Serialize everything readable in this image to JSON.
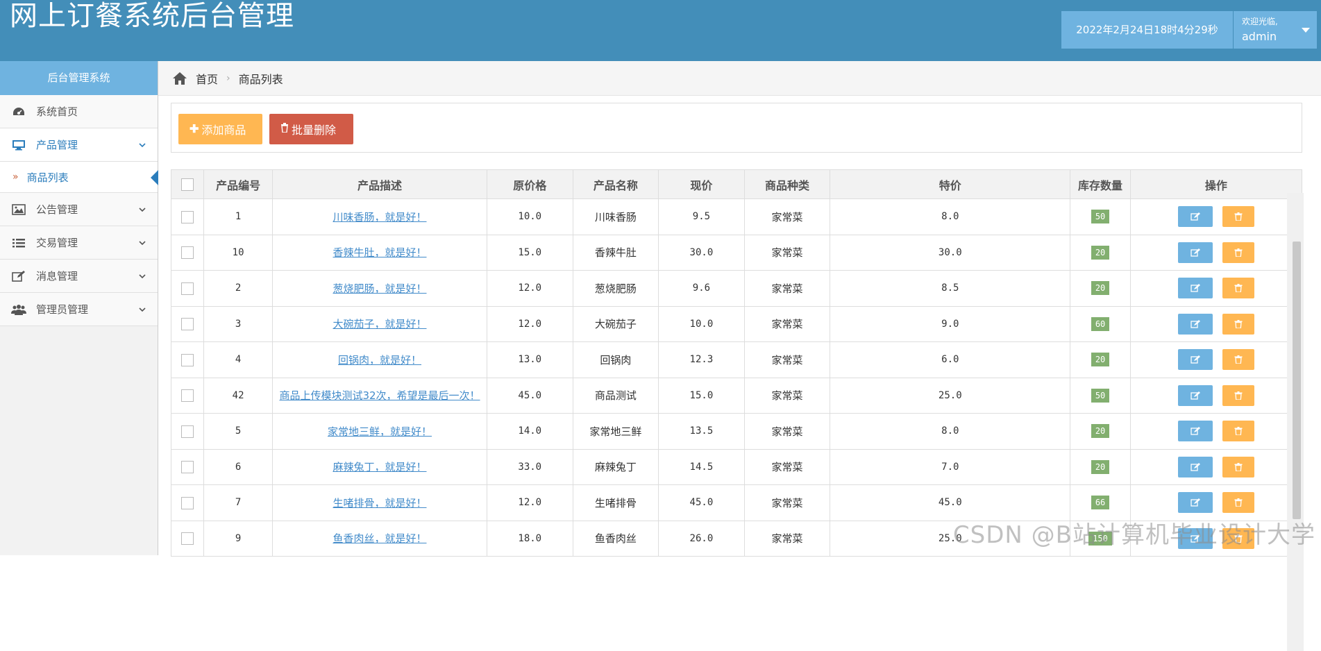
{
  "header": {
    "app_title": "网上订餐系统后台管理",
    "datetime": "2022年2月24日18时4分29秒",
    "welcome": "欢迎光临,",
    "username": "admin"
  },
  "sidebar": {
    "title": "后台管理系统",
    "items": [
      {
        "label": "系统首页",
        "icon": "dashboard-icon"
      },
      {
        "label": "产品管理",
        "icon": "desktop-icon"
      },
      {
        "label": "公告管理",
        "icon": "picture-icon"
      },
      {
        "label": "交易管理",
        "icon": "list-icon"
      },
      {
        "label": "消息管理",
        "icon": "edit-icon"
      },
      {
        "label": "管理员管理",
        "icon": "users-icon"
      }
    ],
    "sub_item": "商品列表"
  },
  "breadcrumb": {
    "home": "首页",
    "current": "商品列表"
  },
  "toolbar": {
    "add_label": "添加商品",
    "delete_label": "批量删除"
  },
  "table": {
    "headers": [
      "产品编号",
      "产品描述",
      "原价格",
      "产品名称",
      "现价",
      "商品种类",
      "特价",
      "库存数量",
      "操作"
    ],
    "rows": [
      {
        "id": "1",
        "desc": "川味香肠，就是好！",
        "orig": "10.0",
        "name": "川味香肠",
        "price": "9.5",
        "type": "家常菜",
        "special": "8.0",
        "stock": "50"
      },
      {
        "id": "10",
        "desc": "香辣牛肚，就是好！",
        "orig": "15.0",
        "name": "香辣牛肚",
        "price": "30.0",
        "type": "家常菜",
        "special": "30.0",
        "stock": "20"
      },
      {
        "id": "2",
        "desc": "葱烧肥肠，就是好！",
        "orig": "12.0",
        "name": "葱烧肥肠",
        "price": "9.6",
        "type": "家常菜",
        "special": "8.5",
        "stock": "20"
      },
      {
        "id": "3",
        "desc": "大碗茄子，就是好！",
        "orig": "12.0",
        "name": "大碗茄子",
        "price": "10.0",
        "type": "家常菜",
        "special": "9.0",
        "stock": "60"
      },
      {
        "id": "4",
        "desc": "回锅肉，就是好！",
        "orig": "13.0",
        "name": "回锅肉",
        "price": "12.3",
        "type": "家常菜",
        "special": "6.0",
        "stock": "20"
      },
      {
        "id": "42",
        "desc": "商品上传模块测试32次，希望是最后一次！",
        "orig": "45.0",
        "name": "商品测试",
        "price": "15.0",
        "type": "家常菜",
        "special": "25.0",
        "stock": "50"
      },
      {
        "id": "5",
        "desc": "家常地三鲜，就是好！",
        "orig": "14.0",
        "name": "家常地三鲜",
        "price": "13.5",
        "type": "家常菜",
        "special": "8.0",
        "stock": "20"
      },
      {
        "id": "6",
        "desc": "麻辣兔丁，就是好！",
        "orig": "33.0",
        "name": "麻辣兔丁",
        "price": "14.5",
        "type": "家常菜",
        "special": "7.0",
        "stock": "20"
      },
      {
        "id": "7",
        "desc": "生啫排骨，就是好！",
        "orig": "12.0",
        "name": "生啫排骨",
        "price": "45.0",
        "type": "家常菜",
        "special": "45.0",
        "stock": "66"
      },
      {
        "id": "9",
        "desc": "鱼香肉丝，就是好！",
        "orig": "18.0",
        "name": "鱼香肉丝",
        "price": "26.0",
        "type": "家常菜",
        "special": "25.0",
        "stock": "150"
      }
    ]
  },
  "watermark": "CSDN @B站计算机毕业设计大学"
}
